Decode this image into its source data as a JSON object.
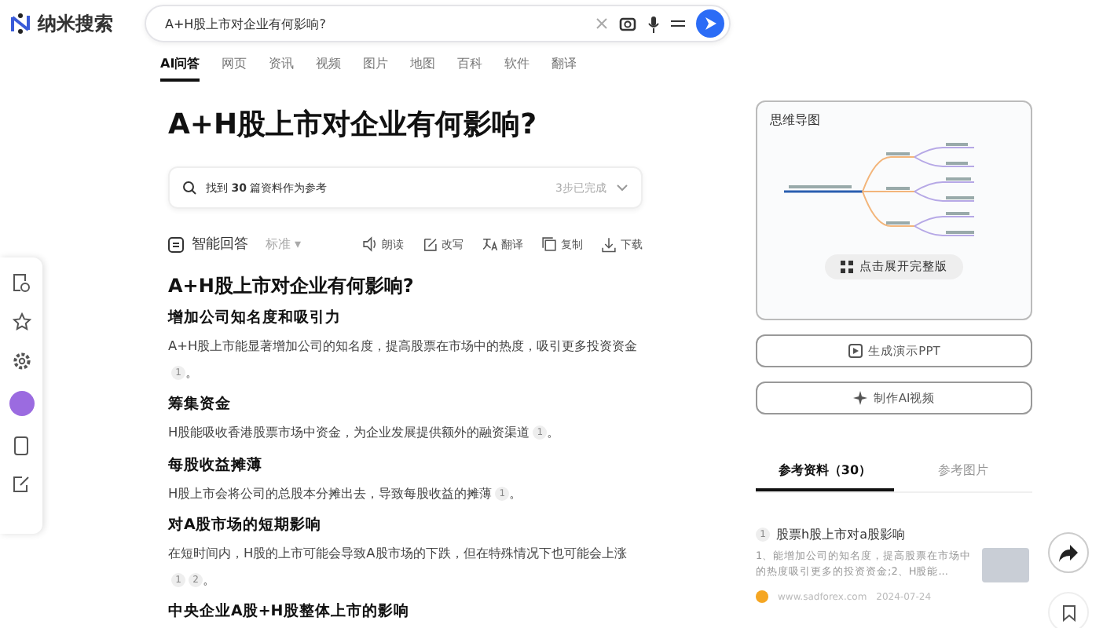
{
  "logo": {
    "text": "纳米搜索"
  },
  "search": {
    "value": "A+H股上市对企业有何影响?"
  },
  "tabs": [
    {
      "label": "AI问答",
      "selected": true
    },
    {
      "label": "网页",
      "selected": false
    },
    {
      "label": "资讯",
      "selected": false
    },
    {
      "label": "视频",
      "selected": false
    },
    {
      "label": "图片",
      "selected": false
    },
    {
      "label": "地图",
      "selected": false
    },
    {
      "label": "百科",
      "selected": false
    },
    {
      "label": "软件",
      "selected": false
    },
    {
      "label": "翻译",
      "selected": false
    }
  ],
  "title": "A+H股上市对企业有何影响?",
  "sources_bar": {
    "text": "找到 **30** 篇资料作为参考",
    "status": "3步已完成",
    "expanded": false
  },
  "answer_toolbar": {
    "label": "智能回答",
    "mode": "标准",
    "mode_caret": "▾",
    "actions": [
      "朗读",
      "改写",
      "翻译",
      "复制",
      "下载"
    ]
  },
  "answer": {
    "heading": "A+H股上市对企业有何影响?",
    "sections": [
      {
        "heading": "增加公司知名度和吸引力",
        "text": "A+H股上市能显著增加公司的知名度，提高股票在市场中的热度，吸引更多投资资金",
        "cites": [
          "1"
        ],
        "end": "。"
      },
      {
        "heading": "筹集资金",
        "text": "H股能吸收香港股票市场中资金，为企业发展提供额外的融资渠道",
        "cites": [
          "1"
        ],
        "end": "。"
      },
      {
        "heading": "每股收益摊薄",
        "text": "H股上市会将公司的总股本分摊出去，导致每股收益的摊薄",
        "cites": [
          "1"
        ],
        "end": "。"
      },
      {
        "heading": "对A股市场的短期影响",
        "text": "在短时间内，H股的上市可能会导致A股市场的下跌，但在特殊情况下也可能会上涨",
        "cites": [
          "1",
          "2"
        ],
        "end": "。"
      },
      {
        "heading": "中央企业A股+H股整体上市的影响"
      }
    ]
  },
  "mind_map": {
    "title": "思维导图",
    "expand_label": "点击展开完整版"
  },
  "side_buttons": [
    {
      "kind": "ppt",
      "label": "生成演示PPT"
    },
    {
      "kind": "video",
      "label": "制作AI视频"
    }
  ],
  "ref_tabs": [
    {
      "label": "参考资料（30）",
      "selected": true
    },
    {
      "label": "参考图片",
      "selected": false
    }
  ],
  "references": [
    {
      "index": "1",
      "title": "股票h股上市对a股影响",
      "snippet": "1、能增加公司的知名度，提高股票在市场中的热度吸引更多的投资资金;2、H股能...",
      "site": "www.sadforex.com",
      "date": "2024-07-24"
    }
  ]
}
